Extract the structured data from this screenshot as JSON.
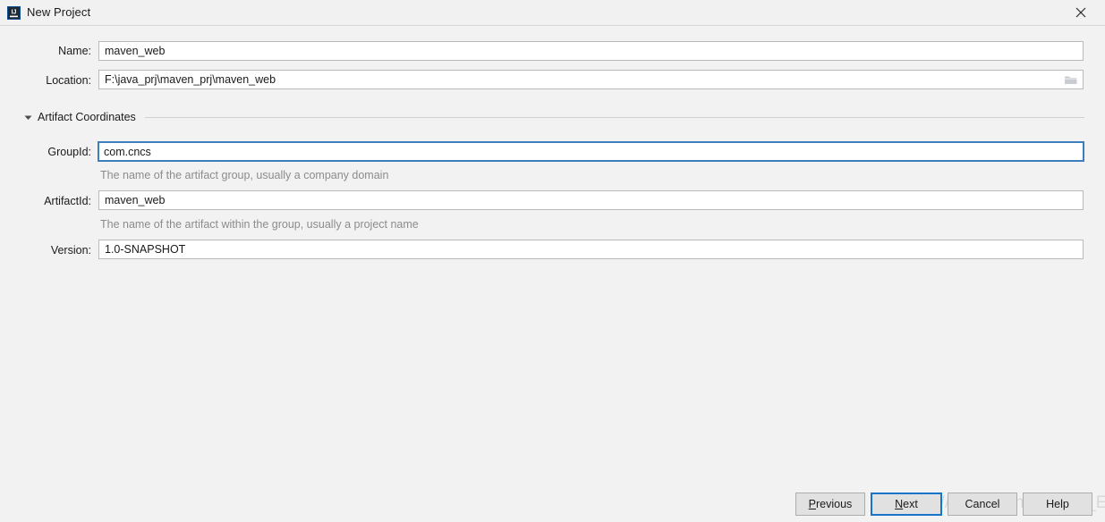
{
  "window": {
    "title": "New Project",
    "icon": "intellij-idea-icon",
    "close_icon": "close-icon"
  },
  "form": {
    "name": {
      "label": "Name:",
      "value": "maven_web",
      "placeholder": ""
    },
    "location": {
      "label": "Location:",
      "value": "F:\\java_prj\\maven_prj\\maven_web",
      "placeholder": "",
      "browse_icon": "folder-browse-icon"
    }
  },
  "section": {
    "title": "Artifact Coordinates",
    "expanded_arrow": "chevron-down-icon",
    "fields": {
      "group_id": {
        "label": "GroupId:",
        "value": "com.cncs",
        "placeholder": "",
        "hint": "The name of the artifact group, usually a company domain",
        "focused": true
      },
      "artifact_id": {
        "label": "ArtifactId:",
        "value": "maven_web",
        "placeholder": "",
        "hint": "The name of the artifact within the group, usually a project name",
        "focused": false
      },
      "version": {
        "label": "Version:",
        "value": "1.0-SNAPSHOT",
        "placeholder": "",
        "hint": "",
        "focused": false
      }
    }
  },
  "buttons": {
    "previous": {
      "label": "Previous",
      "mnemonic": "P"
    },
    "next": {
      "label": "Next",
      "mnemonic": "N"
    },
    "cancel": {
      "label": "Cancel",
      "mnemonic": ""
    },
    "help": {
      "label": "Help",
      "mnemonic": ""
    }
  },
  "watermark": {
    "text": "https://blog.csdn.net/Ur1_Eyes"
  },
  "colors": {
    "dialog_background": "#f2f2f2",
    "titlebar_background": "#f1f1f1",
    "focus_blue": "#3d7ebf",
    "default_button_blue": "#1675c8",
    "hint_gray": "#8c8c8c",
    "icon_blue": "#1f6fc4"
  }
}
